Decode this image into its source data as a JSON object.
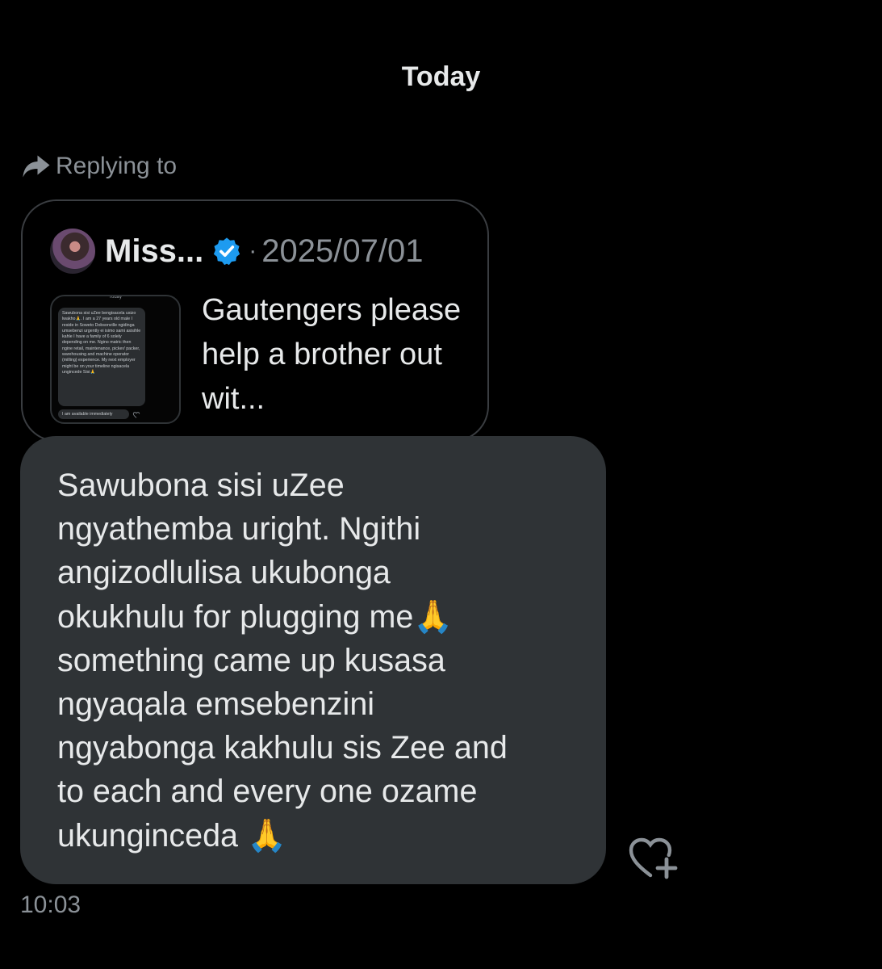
{
  "conversation": {
    "day_separator": "Today"
  },
  "reply_context": {
    "label": "Replying to"
  },
  "quoted_post": {
    "author_name": "Miss...",
    "dot": "·",
    "date": "2025/07/01",
    "text": "Gautengers please help a brother out wit...",
    "thumbnail": {
      "header": "Today",
      "message": "Sawubona sisi uZee bengisacela usizo lwakho🙏. I am a 27 years old male I reside in Soweto Dobsonville ngidinga umsebenzi urgently ei isimo sami asisihle kahle I have a family of 6 solely depending on me. Ngino matric then ngine retail, maintenance, picker/ packer, warehousing and machine operator (milling) experience. My next employer might be on your timeline ngisacela ungincede Sisi🙏",
      "second_message": "I am available immediately"
    }
  },
  "message": {
    "text": "Sawubona sisi uZee\nngyathemba uright. Ngithi\nangizodlulisa ukubonga\nokukhulu for plugging me🙏\nsomething came up kusasa\nngyaqala emsebenzini\nngyabonga kakhulu sis Zee and\nto each and every one ozame\nukunginceda 🙏",
    "time": "10:03"
  },
  "icons": {
    "reply_arrow": "reply-arrow-icon",
    "verified": "verified-badge-icon",
    "add_reaction": "add-reaction-icon"
  },
  "colors": {
    "background": "#000000",
    "bubble": "#2f3336",
    "text_primary": "#e7e9ea",
    "text_secondary": "#8b9197",
    "verified_blue": "#1d9bf0"
  }
}
